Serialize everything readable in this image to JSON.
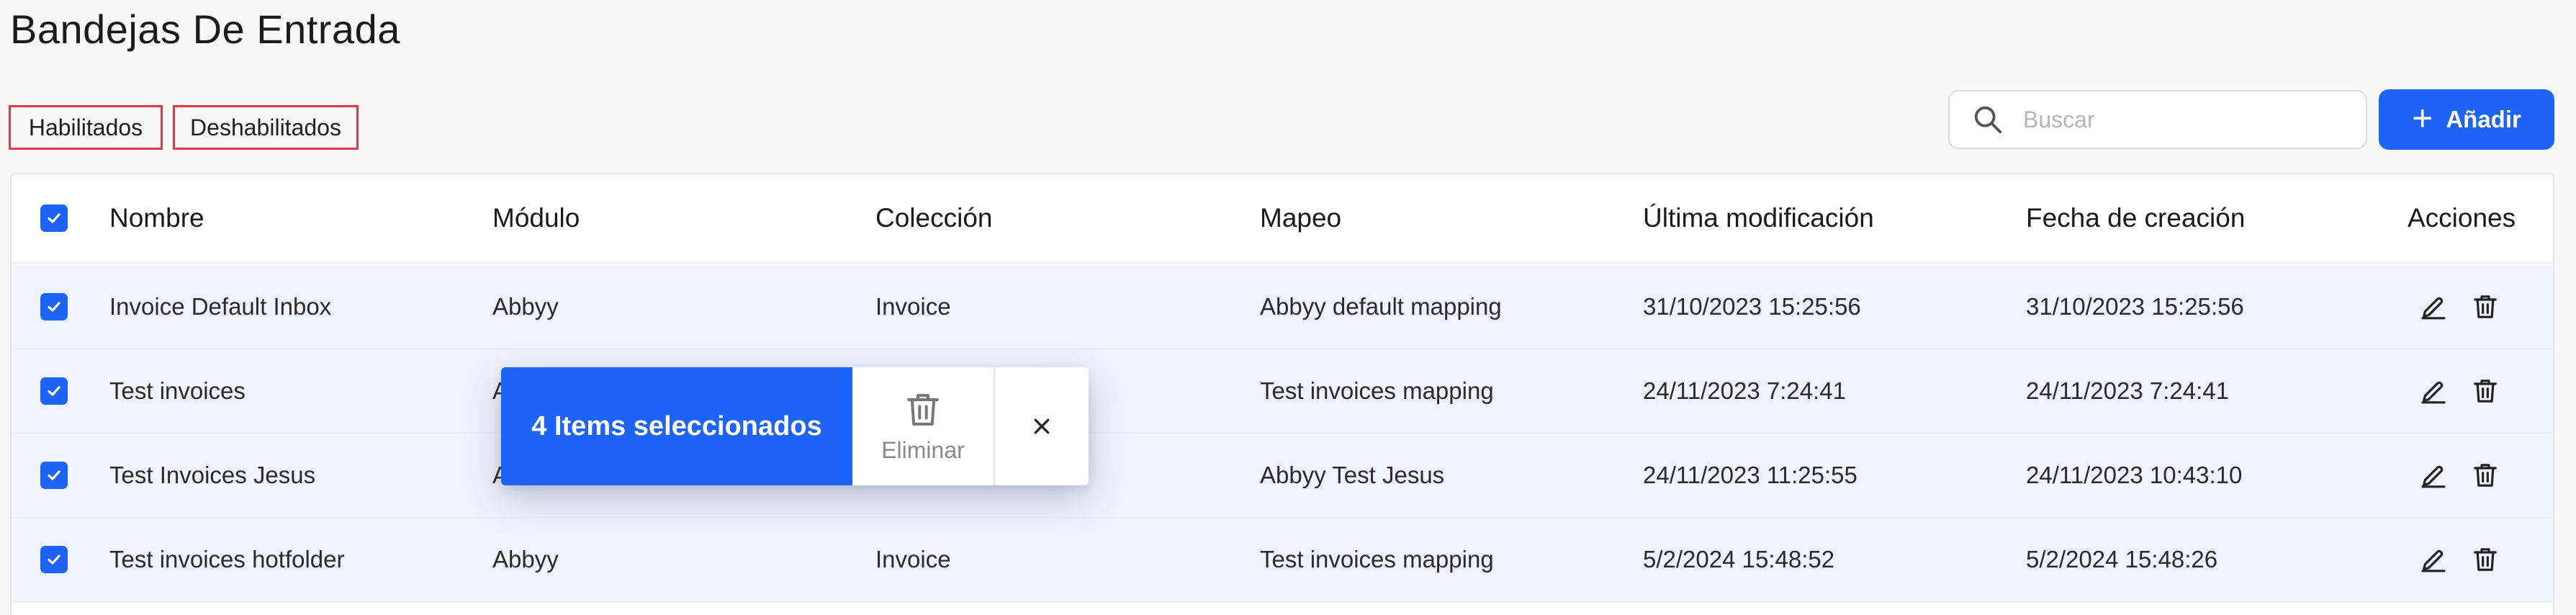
{
  "page": {
    "title": "Bandejas De Entrada"
  },
  "filters": {
    "enabled_label": "Habilitados",
    "disabled_label": "Deshabilitados"
  },
  "search": {
    "placeholder": "Buscar",
    "value": ""
  },
  "toolbar": {
    "add_label": "Añadir",
    "add_icon": "plus-icon"
  },
  "colors": {
    "accent": "#1d63f8",
    "tab_border": "#e03a4a",
    "selected_row": "#eef3fd"
  },
  "table": {
    "columns": [
      "Nombre",
      "Módulo",
      "Colección",
      "Mapeo",
      "Última modificación",
      "Fecha de creación",
      "Acciones"
    ],
    "rows": [
      {
        "nombre": "Invoice Default Inbox",
        "modulo": "Abbyy",
        "coleccion": "Invoice",
        "mapeo": "Abbyy default mapping",
        "ultima": "31/10/2023 15:25:56",
        "fecha": "31/10/2023 15:25:56",
        "selected": true
      },
      {
        "nombre": "Test invoices",
        "modulo": "A",
        "coleccion": "",
        "mapeo": "Test invoices mapping",
        "ultima": "24/11/2023 7:24:41",
        "fecha": "24/11/2023 7:24:41",
        "selected": true
      },
      {
        "nombre": "Test Invoices Jesus",
        "modulo": "A",
        "coleccion": "",
        "mapeo": "Abbyy Test Jesus",
        "ultima": "24/11/2023 11:25:55",
        "fecha": "24/11/2023 10:43:10",
        "selected": true
      },
      {
        "nombre": "Test invoices hotfolder",
        "modulo": "Abbyy",
        "coleccion": "Invoice",
        "mapeo": "Test invoices mapping",
        "ultima": "5/2/2024 15:48:52",
        "fecha": "5/2/2024 15:48:26",
        "selected": true
      }
    ]
  },
  "selection_bar": {
    "count_label": "4 Items seleccionados",
    "delete_label": "Eliminar"
  }
}
